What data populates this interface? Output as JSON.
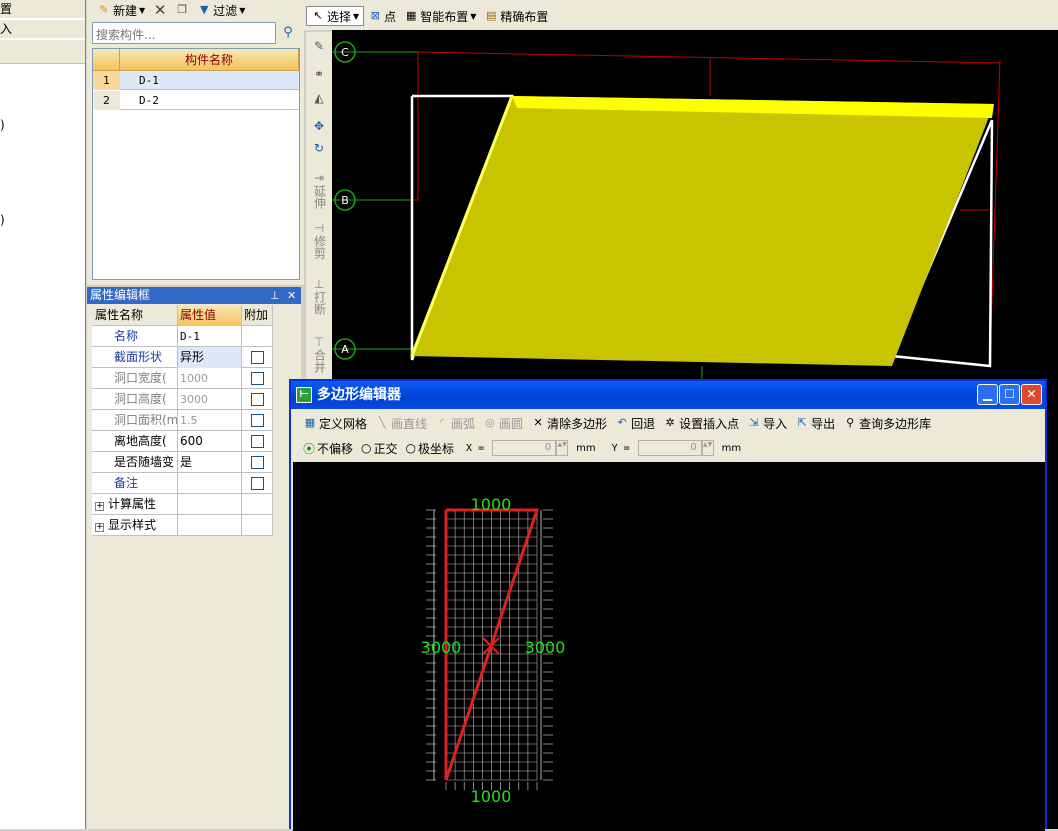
{
  "left_panel": {
    "rows": [
      "置",
      "入",
      ")",
      ")"
    ]
  },
  "component_toolbar": {
    "new_label": "新建",
    "filter_label": "过滤"
  },
  "search": {
    "placeholder": "搜索构件..."
  },
  "component_table": {
    "header": "构件名称",
    "rows": [
      {
        "index": "1",
        "name": "D-1"
      },
      {
        "index": "2",
        "name": "D-2"
      }
    ]
  },
  "property_panel": {
    "title": "属性编辑框",
    "headers": {
      "name": "属性名称",
      "value": "属性值",
      "extra": "附加"
    },
    "rows": [
      {
        "name": "名称",
        "value": "D-1",
        "has_checkbox": false
      },
      {
        "name": "截面形状",
        "value": "异形",
        "has_checkbox": true
      },
      {
        "name": "洞口宽度(",
        "value": "1000",
        "has_checkbox": true
      },
      {
        "name": "洞口高度(",
        "value": "3000",
        "has_checkbox": true
      },
      {
        "name": "洞口面积(m",
        "value": "1.5",
        "has_checkbox": true
      },
      {
        "name": "离地高度(",
        "value": "600",
        "has_checkbox": true
      },
      {
        "name": "是否随墙变",
        "value": "是",
        "has_checkbox": true
      },
      {
        "name": "备注",
        "value": "",
        "has_checkbox": true
      },
      {
        "name": "计算属性",
        "value": "",
        "has_checkbox": false
      },
      {
        "name": "显示样式",
        "value": "",
        "has_checkbox": false
      }
    ]
  },
  "canvas_toolbar": {
    "select": "选择",
    "point": "点",
    "smart": "智能布置",
    "precise": "精确布置"
  },
  "vertical_toolbar": {
    "extend": "延伸",
    "trim": "修剪",
    "break": "打断",
    "merge": "合并"
  },
  "axes": {
    "c": "C",
    "b": "B",
    "a": "A"
  },
  "colors": {
    "slab": "#c8c400",
    "slab_top": "#ffff00",
    "grid_line": "#c00000",
    "axis_green": "#20e020"
  },
  "polygon_editor": {
    "title": "多边形编辑器",
    "toolbar": {
      "define_grid": "定义网格",
      "draw_line": "画直线",
      "draw_arc": "画弧",
      "draw_circle": "画圆",
      "clear_polygon": "清除多边形",
      "undo": "回退",
      "set_insert_point": "设置插入点",
      "import": "导入",
      "export": "导出",
      "query_library": "查询多边形库"
    },
    "options": {
      "no_offset": "不偏移",
      "orthogonal": "正交",
      "polar": "极坐标",
      "x_label": "X =",
      "x_value": "0",
      "y_label": "Y =",
      "y_value": "0",
      "unit": "mm"
    },
    "dimensions": {
      "top": "1000",
      "left": "3000",
      "right": "3000",
      "bottom": "1000"
    }
  }
}
